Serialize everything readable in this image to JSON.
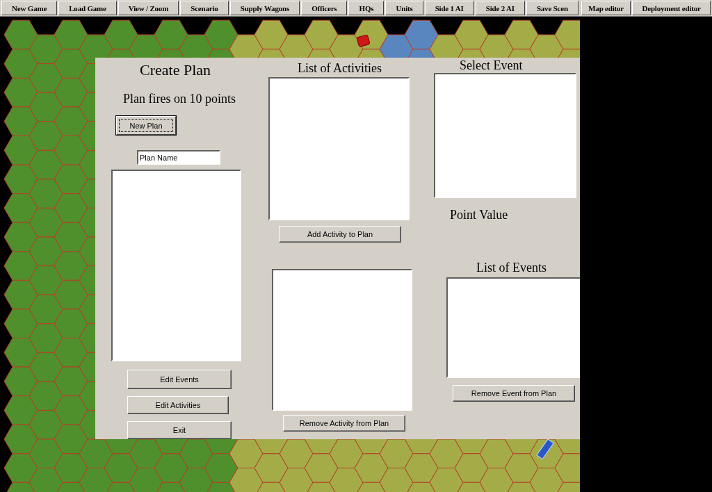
{
  "toolbar": {
    "buttons": [
      "New Game",
      "Load Game",
      "View / Zoom",
      "Scenario",
      "Supply Wagons",
      "Officers",
      "HQs",
      "Units",
      "Side 1 AI",
      "Side 2 AI",
      "Save Scen"
    ],
    "editor_buttons": [
      "Map editor",
      "Deployment editor"
    ]
  },
  "dialog": {
    "title": "Create Plan",
    "subtitle": "Plan fires on 10 points",
    "new_plan_button": "New Plan",
    "plan_name": {
      "value": "Plan Name"
    },
    "activities_heading": "List of Activities",
    "add_activity_button": "Add Activity to Plan",
    "remove_activity_button": "Remove Activity from Plan",
    "select_event_heading": "Select Event",
    "point_value_label": "Point Value",
    "events_heading": "List of Events",
    "remove_event_button": "Remove Event from Plan",
    "bottom_buttons": [
      "Edit Events",
      "Edit Activities",
      "Exit"
    ]
  }
}
